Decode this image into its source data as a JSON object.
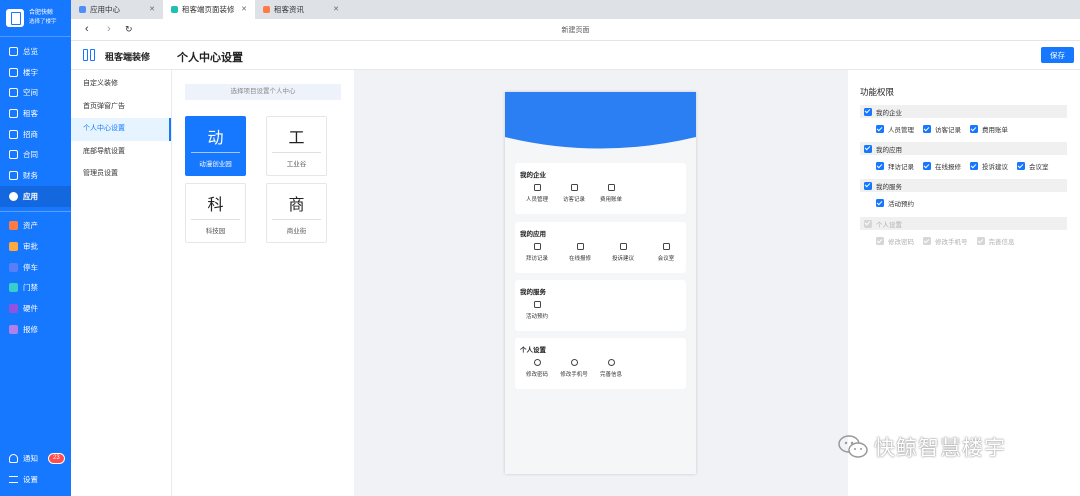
{
  "brand": {
    "line1": "合肥快鲸",
    "line2": "选择了楼宇"
  },
  "nav": {
    "items": [
      "总览",
      "楼宇",
      "空间",
      "租客",
      "招商",
      "合同",
      "财务",
      "应用"
    ],
    "active_index": 7,
    "apps": [
      {
        "label": "资产",
        "color": "#ff7a45"
      },
      {
        "label": "审批",
        "color": "#ffa940"
      },
      {
        "label": "停车",
        "color": "#597ef7"
      },
      {
        "label": "门禁",
        "color": "#36cfc9"
      },
      {
        "label": "硬件",
        "color": "#9254de"
      },
      {
        "label": "报修",
        "color": "#b37feb"
      }
    ],
    "notify_label": "通知",
    "notify_count": "23",
    "settings_label": "设置"
  },
  "tabs": [
    {
      "label": "应用中心",
      "color": "#4f8ef7"
    },
    {
      "label": "租客端页面装修",
      "color": "#20c0b0"
    },
    {
      "label": "租客资讯",
      "color": "#ff7a45"
    }
  ],
  "active_tab": 1,
  "toolbar": {
    "back": "‹",
    "forward": "›",
    "reload": "↻",
    "page_caption": "新建页面"
  },
  "header": {
    "app_title": "租客端装修",
    "page_title": "个人中心设置",
    "save_label": "保存"
  },
  "submenu": {
    "items": [
      "自定义装修",
      "首页弹窗广告",
      "个人中心设置",
      "底部导航设置",
      "管理员设置"
    ],
    "active_index": 2
  },
  "selector": {
    "placeholder": "选择项目设置个人中心",
    "cards": [
      {
        "char": "动",
        "label": "动漫创业园",
        "selected": true
      },
      {
        "char": "工",
        "label": "工业谷",
        "selected": false
      },
      {
        "char": "科",
        "label": "科技园",
        "selected": false
      },
      {
        "char": "商",
        "label": "商业街",
        "selected": false
      }
    ]
  },
  "phone": {
    "header_color": "#2b7ff2",
    "sections": [
      {
        "title": "我的企业",
        "items": [
          "人员管理",
          "访客记录",
          "费用账单"
        ]
      },
      {
        "title": "我的应用",
        "items": [
          "拜访记录",
          "在线报修",
          "投诉建议",
          "会议室"
        ]
      },
      {
        "title": "我的服务",
        "items": [
          "活动预约"
        ]
      },
      {
        "title": "个人设置",
        "items": [
          "修改密码",
          "修改手机号",
          "完善信息"
        ]
      }
    ]
  },
  "permissions": {
    "title": "功能权限",
    "groups": [
      {
        "label": "我的企业",
        "enabled": true,
        "options": [
          "人员管理",
          "访客记录",
          "费用账单"
        ]
      },
      {
        "label": "我的应用",
        "enabled": true,
        "options": [
          "拜访记录",
          "在线报修",
          "投诉建议",
          "会议室"
        ]
      },
      {
        "label": "我的服务",
        "enabled": true,
        "options": [
          "活动预约"
        ]
      },
      {
        "label": "个人设置",
        "enabled": false,
        "options": [
          "修改密码",
          "修改手机号",
          "完善信息"
        ]
      }
    ]
  },
  "watermark": {
    "text": "快鲸智慧楼宇"
  }
}
